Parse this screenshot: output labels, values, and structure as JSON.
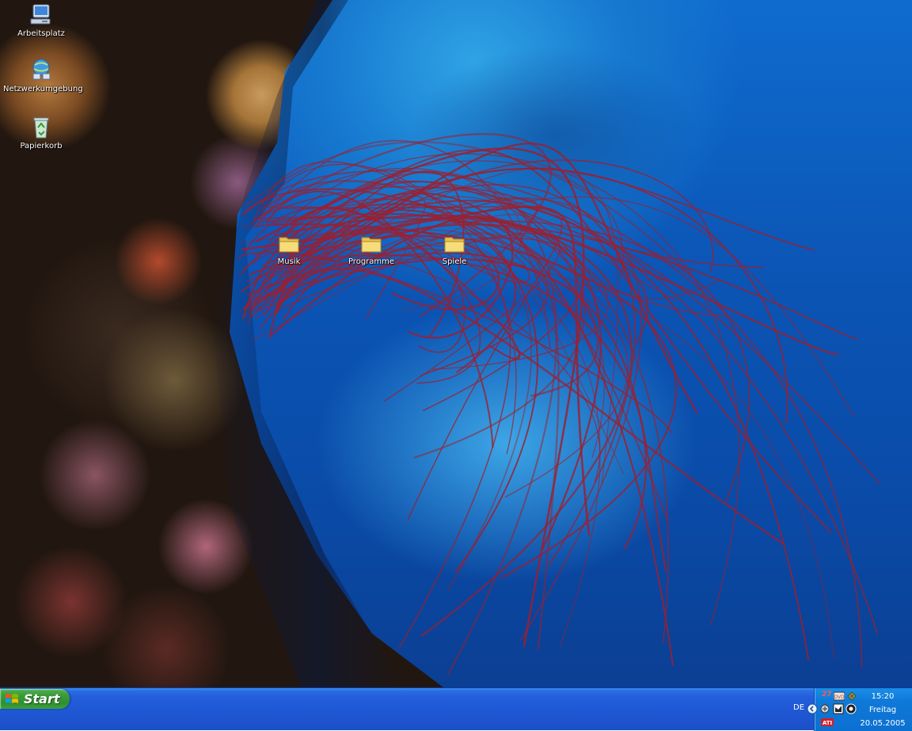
{
  "desktop": {
    "system_icons": [
      {
        "label": "Arbeitsplatz",
        "icon": "my-computer-icon"
      },
      {
        "label": "Netzwerkumgebung",
        "icon": "network-places-icon"
      },
      {
        "label": "Papierkorb",
        "icon": "recycle-bin-icon"
      }
    ],
    "folders": [
      {
        "label": "Musik",
        "icon": "folder-icon"
      },
      {
        "label": "Programme",
        "icon": "folder-icon"
      },
      {
        "label": "Spiele",
        "icon": "folder-icon"
      }
    ]
  },
  "taskbar": {
    "start_label": "Start",
    "language": "DE",
    "tray_badge": "27",
    "tray_icons": [
      "notification-icon",
      "dvd-icon",
      "network-icon",
      "volume-icon",
      "media-icon",
      "ati-icon"
    ],
    "clock": {
      "time": "15:20",
      "weekday": "Freitag",
      "date": "20.05.2005"
    }
  },
  "colors": {
    "taskbar_blue": "#245edb",
    "start_green": "#3c9c3c",
    "tray_blue": "#0f79d8",
    "coral_red": "#9c1f2f"
  }
}
